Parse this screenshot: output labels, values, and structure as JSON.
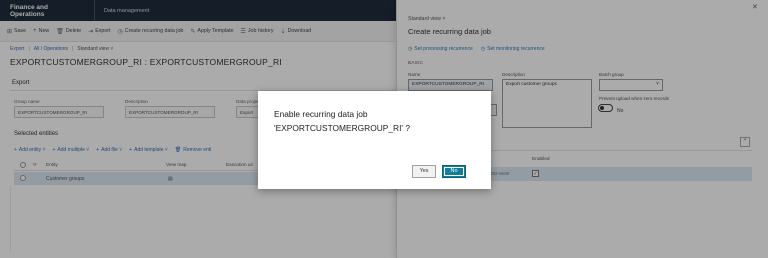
{
  "topbar": {
    "app_title": "Finance and Operations",
    "workspace": "Data management"
  },
  "actions": [
    {
      "icon": "⊞",
      "label": "Save"
    },
    {
      "icon": "+",
      "label": "New"
    },
    {
      "icon": "🗑",
      "label": "Delete"
    },
    {
      "icon": "⇥",
      "label": "Export"
    },
    {
      "icon": "◷",
      "label": "Create recurring data job"
    },
    {
      "icon": "✎",
      "label": "Apply Template"
    },
    {
      "icon": "☰",
      "label": "Job history"
    },
    {
      "icon": "⇣",
      "label": "Download"
    }
  ],
  "breadcrumb": {
    "item1": "Export",
    "sep": "|",
    "item2": "All / Operations",
    "view": "Standard view ˅"
  },
  "record_title": "EXPORTCUSTOMERGROUP_RI : EXPORTCUSTOMERGROUP_RI",
  "export_section": {
    "heading": "Export",
    "name_label": "Group name",
    "name_value": "EXPORTCUSTOMERGROUP_RI",
    "desc_label": "Description",
    "desc_value": "EXPORTCUSTOMERGROUP_RI",
    "data_label": "Data project",
    "data_value": "Export"
  },
  "entities": {
    "heading": "Selected entities",
    "toolbar": [
      {
        "icon": "+",
        "label": "Add entity ˅"
      },
      {
        "icon": "+",
        "label": "Add multiple ˅"
      },
      {
        "icon": "+",
        "label": "Add file ˅"
      },
      {
        "icon": "+",
        "label": "Add template ˅"
      },
      {
        "icon": "🗑",
        "label": "Remove enti"
      }
    ],
    "columns": [
      "Entity",
      "View map",
      "Execution un"
    ],
    "rows": [
      {
        "entity": "Customer groups",
        "view_map": "▤"
      }
    ]
  },
  "panel": {
    "view": "Standard view ˅",
    "title": "Create recurring data job",
    "links": [
      {
        "icon": "◷",
        "label": "Set processing recurrence"
      },
      {
        "icon": "◷",
        "label": "Set monitoring recurrence"
      }
    ],
    "basic_label": "BASIC",
    "name_label": "Name",
    "name_value": "EXPORTCUSTOMERGROUP_RI",
    "desc_label": "Description",
    "desc_value": "Export customer groups",
    "batch_label": "Batch group",
    "prevent_label": "Prevent upload when zero records",
    "toggle_value": "No",
    "table_header": "Enabled",
    "row_id": "8-f9b62-9e90",
    "row_check": "✓"
  },
  "dialog": {
    "line1": "Enable recurring data job",
    "line2": "'EXPORTCUSTOMERGROUP_RI' ?",
    "yes": "Yes",
    "no": "No"
  }
}
